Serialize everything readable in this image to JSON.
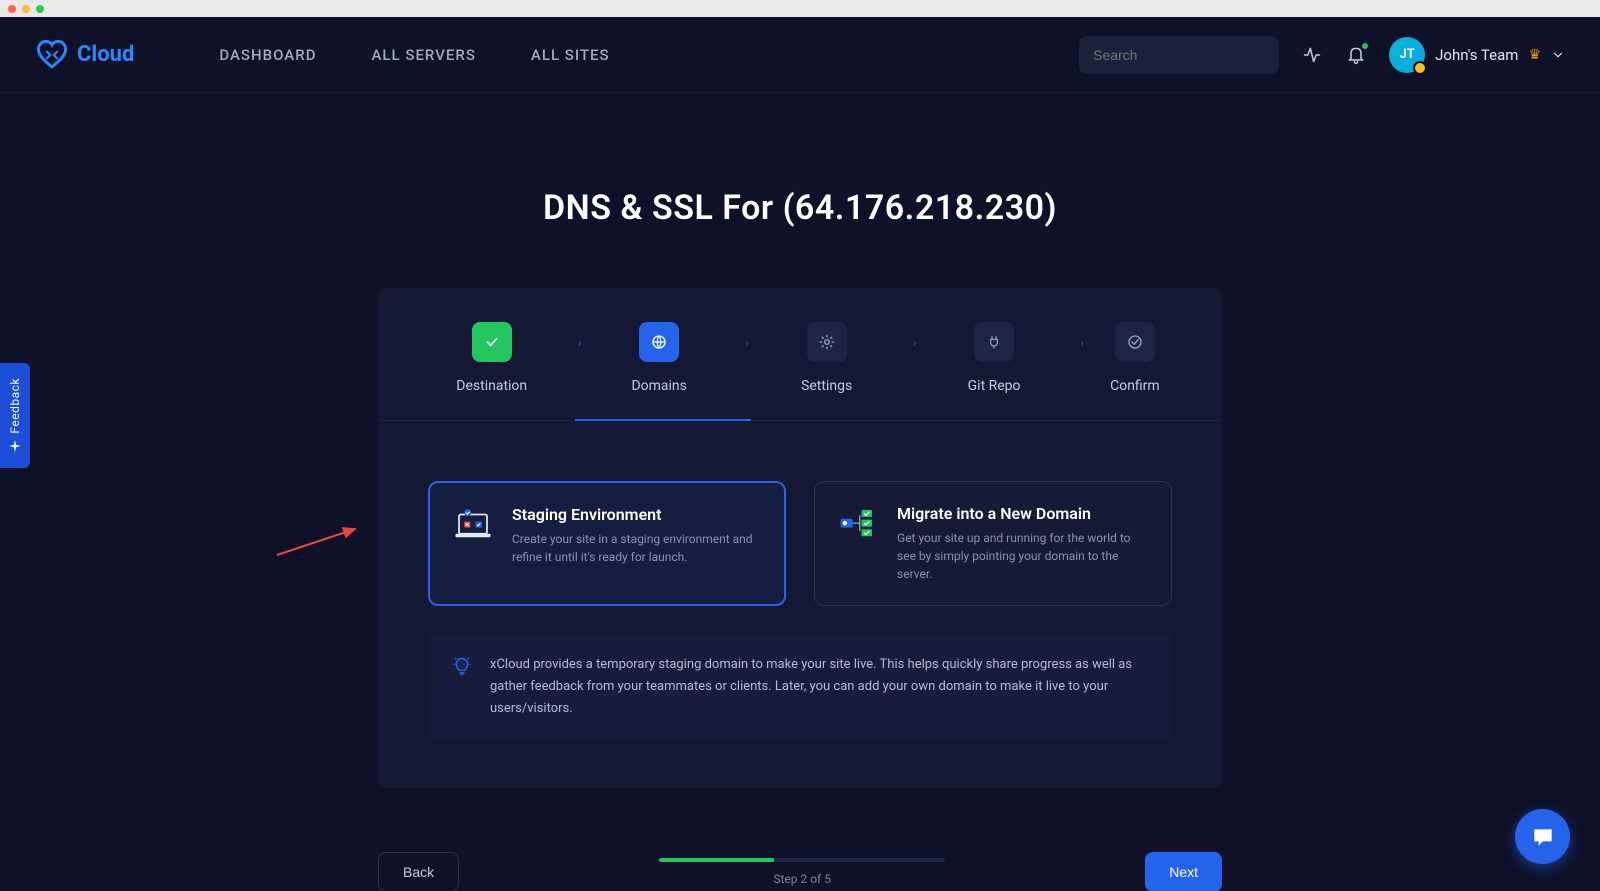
{
  "brand": "Cloud",
  "nav": {
    "dashboard": "DASHBOARD",
    "servers": "ALL SERVERS",
    "sites": "ALL SITES"
  },
  "search": {
    "placeholder": "Search"
  },
  "team": {
    "name": "John's Team",
    "initials": "JT"
  },
  "page_title": "DNS & SSL For (64.176.218.230)",
  "steps": {
    "destination": "Destination",
    "domains": "Domains",
    "settings": "Settings",
    "git": "Git Repo",
    "confirm": "Confirm"
  },
  "options": {
    "staging": {
      "title": "Staging Environment",
      "desc": "Create your site in a staging environment and refine it until it's ready for launch."
    },
    "migrate": {
      "title": "Migrate into a New Domain",
      "desc": "Get your site up and running for the world to see by simply pointing your domain to the server."
    }
  },
  "info_text": "xCloud provides a temporary staging domain to make your site live. This helps quickly share progress as well as gather feedback from your teammates or clients. Later, you can add your own domain to make it live to your users/visitors.",
  "footer": {
    "back": "Back",
    "next": "Next",
    "step_label": "Step 2 of 5",
    "progress_pct": 40
  },
  "feedback_label": "Feedback"
}
